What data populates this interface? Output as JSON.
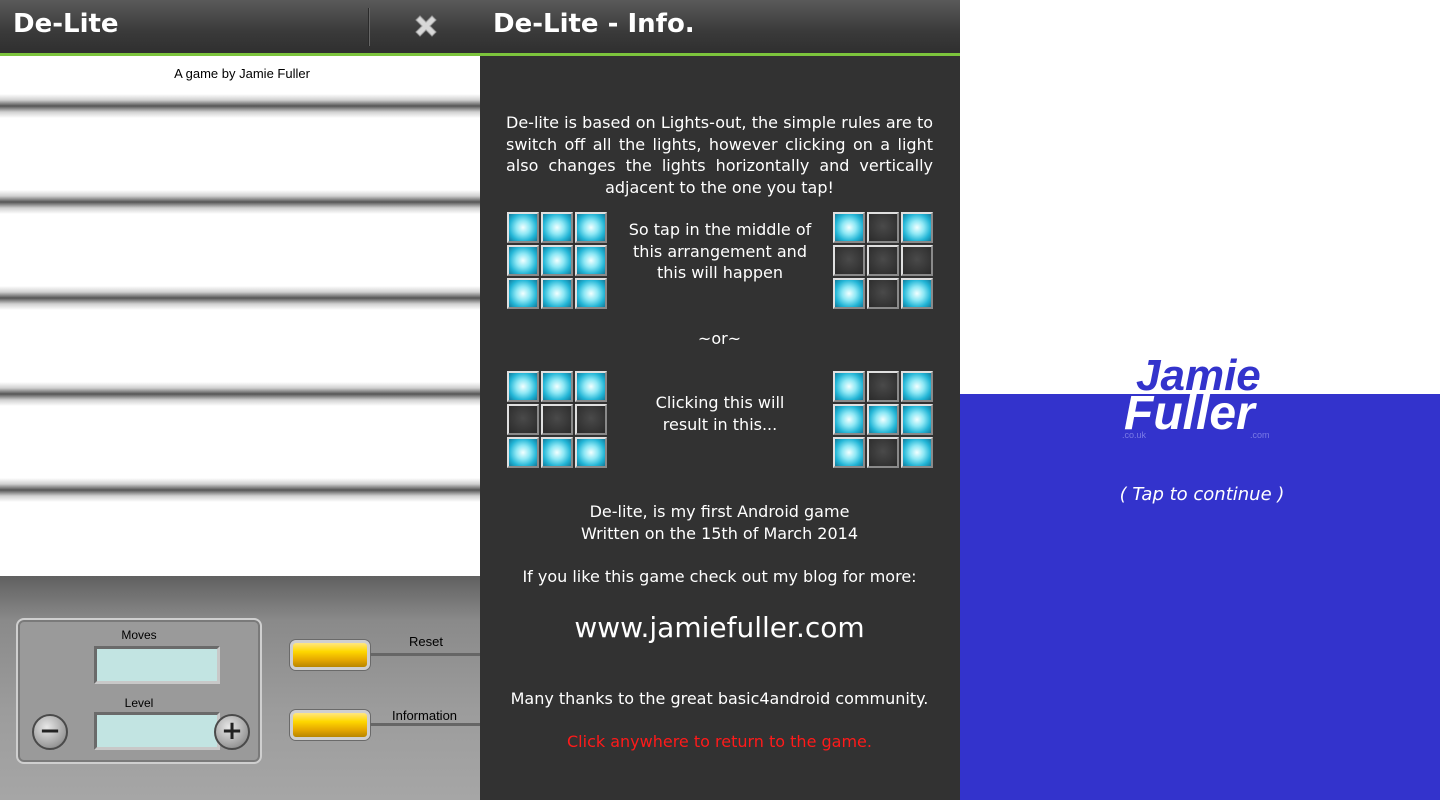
{
  "title_bar": {
    "app_title": "De-Lite",
    "info_title": "De-Lite - Info."
  },
  "game": {
    "byline": "A game by Jamie Fuller",
    "moves_label": "Moves",
    "moves_value": "",
    "level_label": "Level",
    "level_value": "",
    "minus_glyph": "−",
    "plus_glyph": "+",
    "reset_label": "Reset",
    "information_label": "Information"
  },
  "info": {
    "rules": "De-lite is based on Lights-out, the simple rules are to switch off all the lights, however clicking on a light also changes the lights horizontally and vertically adjacent to the one you tap!",
    "example1_caption": "So tap in the middle of this arrangement and this will happen",
    "or_text": "~or~",
    "example2_caption": "Clicking this will result in this...",
    "about_line1": "De-lite, is my first Android game",
    "about_line2": "Written on the 15th of March 2014",
    "blog_text": "If you like this game check out my blog for more:",
    "website": "www.jamiefuller.com",
    "thanks": "Many thanks to the great basic4android community.",
    "return_msg": "Click anywhere to return to the game.",
    "grids": {
      "ex1_before": [
        [
          1,
          1,
          1
        ],
        [
          1,
          1,
          1
        ],
        [
          1,
          1,
          1
        ]
      ],
      "ex1_after": [
        [
          1,
          0,
          1
        ],
        [
          0,
          0,
          0
        ],
        [
          1,
          0,
          1
        ]
      ],
      "ex2_before": [
        [
          1,
          1,
          1
        ],
        [
          0,
          0,
          0
        ],
        [
          1,
          1,
          1
        ]
      ],
      "ex2_after": [
        [
          1,
          0,
          1
        ],
        [
          1,
          1,
          1
        ],
        [
          1,
          0,
          1
        ]
      ]
    }
  },
  "splash": {
    "logo_line1": "Jamie",
    "logo_line2": "Fuller",
    "logo_couk": ".co.uk",
    "logo_com": ".com",
    "tap_text": "( Tap to continue )"
  },
  "colors": {
    "accent_green": "#7cc43c",
    "splash_blue": "#3333cc",
    "return_red": "#ff1a1a",
    "light_on": "#22b5d6"
  }
}
